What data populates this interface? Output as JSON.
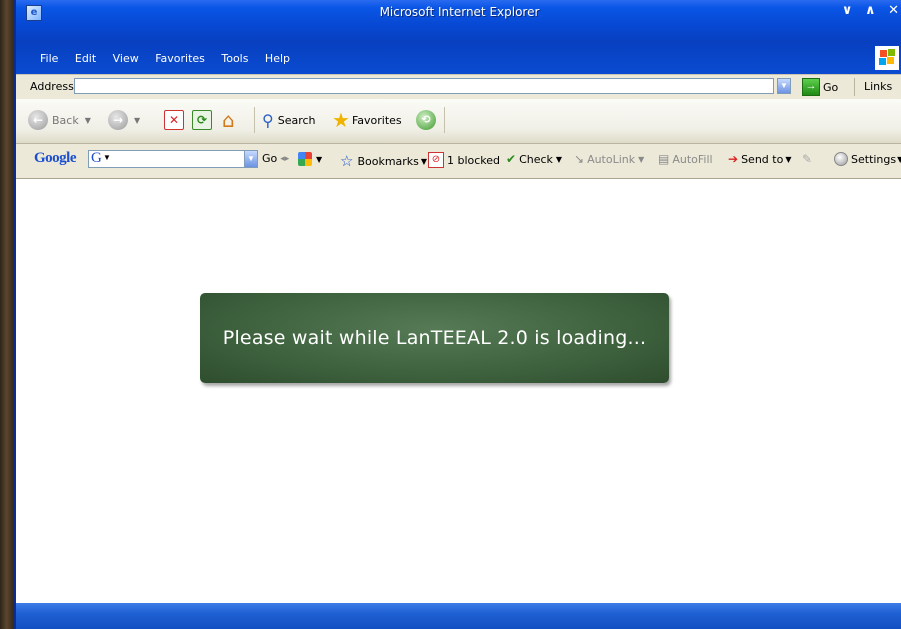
{
  "window": {
    "title": "Microsoft Internet Explorer",
    "controls": [
      "∨",
      "∧",
      "✕"
    ]
  },
  "menu": [
    "File",
    "Edit",
    "View",
    "Favorites",
    "Tools",
    "Help"
  ],
  "address_bar": {
    "label": "Address",
    "value": "",
    "go_label": "Go",
    "links_label": "Links"
  },
  "nav_toolbar": {
    "back_label": "Back",
    "search_label": "Search",
    "favorites_label": "Favorites"
  },
  "google_toolbar": {
    "logo": "Google",
    "go_label": "Go",
    "bookmarks_label": "Bookmarks",
    "blocked_label": "1 blocked",
    "check_label": "Check",
    "autolink_label": "AutoLink",
    "autofill_label": "AutoFill",
    "sendto_label": "Send to",
    "settings_label": "Settings"
  },
  "content": {
    "loading_message": "Please wait while LanTEEAL 2.0 is loading..."
  },
  "colors": {
    "titlebar": "#0a56e6",
    "loader_bg": "#3f633f",
    "toolbar_bg": "#ece9d8"
  }
}
